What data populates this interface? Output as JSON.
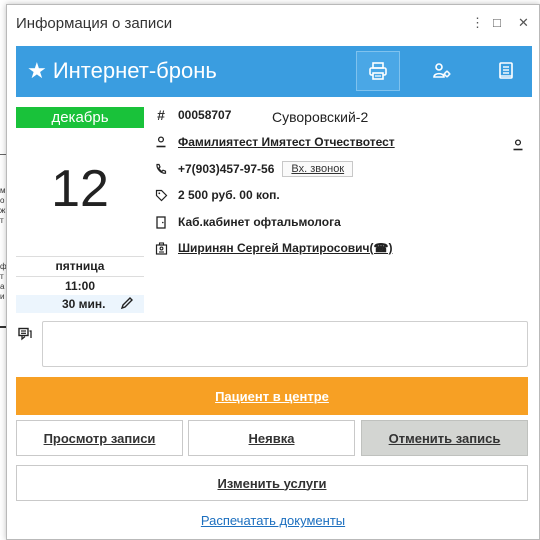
{
  "window": {
    "title": "Информация о записи",
    "controls": {
      "more": "⋮",
      "maximize": "□",
      "close": "✕"
    }
  },
  "header": {
    "title": "★ Интернет-бронь",
    "background_color": "#3a9de0",
    "icons": [
      "printer-icon",
      "user-settings-icon",
      "document-icon"
    ]
  },
  "date": {
    "month": "декабрь",
    "day": "12",
    "weekday": "пятница",
    "time": "11:00",
    "duration": "30 мин.",
    "month_color": "#19c23a"
  },
  "record": {
    "number": "00058707",
    "branch": "Суворовский-2",
    "patient": "Фамилиятест Имятест Отчествотест",
    "phone": "+7(903)457-97-56",
    "call_button": "Вх. звонок",
    "price": "2 500 руб. 00 коп.",
    "room": "Каб.кабинет офтальмолога",
    "doctor": "Ширинян Сергей Мартиросович(☎)"
  },
  "comment": {
    "value": ""
  },
  "actions": {
    "patient_in_center": "Пациент в центре",
    "view_record": "Просмотр записи",
    "no_show": "Неявка",
    "cancel_record": "Отменить запись",
    "change_services": "Изменить услуги",
    "print_documents": "Распечатать документы",
    "orange_color": "#f7a024"
  }
}
